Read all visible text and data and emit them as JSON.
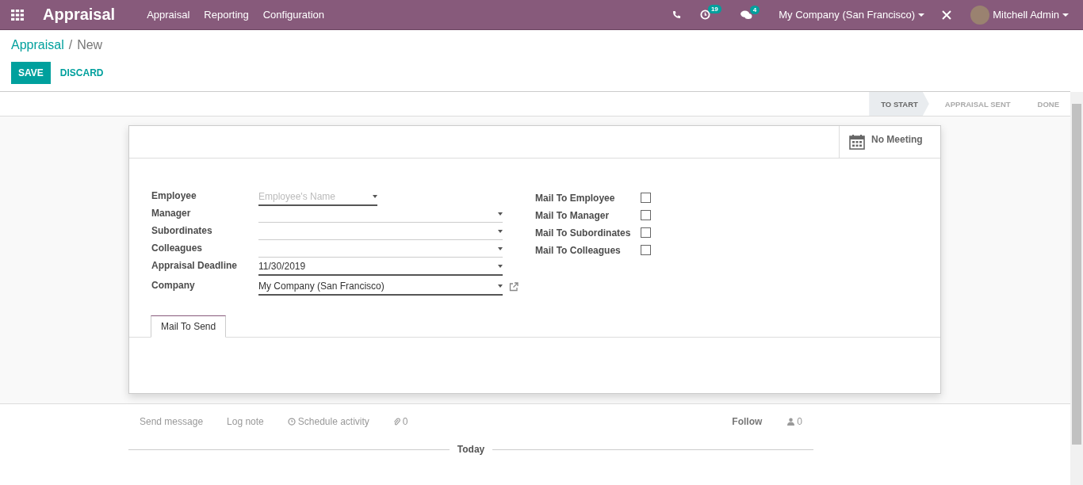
{
  "navbar": {
    "app_title": "Appraisal",
    "menu": [
      "Appraisal",
      "Reporting",
      "Configuration"
    ],
    "activity_count": "19",
    "message_count": "4",
    "company": "My Company (San Francisco)",
    "user": "Mitchell Admin"
  },
  "breadcrumb": {
    "parent": "Appraisal",
    "separator": "/",
    "current": "New"
  },
  "buttons": {
    "save": "SAVE",
    "discard": "DISCARD"
  },
  "stages": [
    {
      "label": "TO START",
      "selected": true
    },
    {
      "label": "APPRAISAL SENT",
      "selected": false
    },
    {
      "label": "DONE",
      "selected": false
    }
  ],
  "meeting_button": "No Meeting",
  "fields": [
    {
      "label": "Employee",
      "placeholder": "Employee's Name"
    },
    {
      "label": "Manager"
    },
    {
      "label": "Subordinates"
    },
    {
      "label": "Colleagues"
    },
    {
      "label": "Appraisal Deadline",
      "value": "11/30/2019"
    },
    {
      "label": "Company",
      "value": "My Company (San Francisco)",
      "external_link": true
    }
  ],
  "mail_options": [
    {
      "label": "Mail To Employee",
      "checked": false
    },
    {
      "label": "Mail To Manager",
      "checked": false
    },
    {
      "label": "Mail To Subordinates",
      "checked": false
    },
    {
      "label": "Mail To Colleagues",
      "checked": false
    }
  ],
  "tabs": [
    {
      "label": "Mail To Send",
      "selected": true
    }
  ],
  "chatter": {
    "send_message": "Send message",
    "log_note": "Log note",
    "schedule_activity": "Schedule activity",
    "attachments": "0",
    "follow": "Follow",
    "followers": "0",
    "divider": "Today"
  }
}
